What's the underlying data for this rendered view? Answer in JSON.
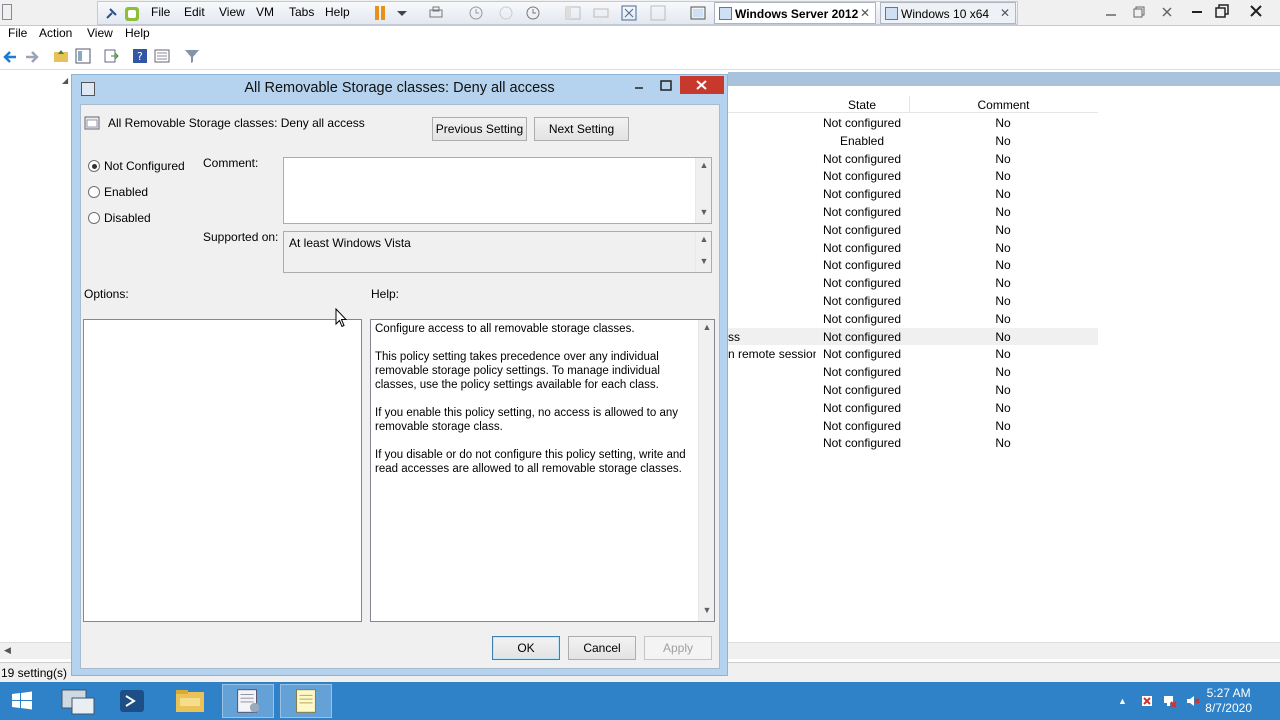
{
  "vmware": {
    "menu": [
      "File",
      "Edit",
      "View",
      "VM",
      "Tabs",
      "Help"
    ],
    "tabs": [
      {
        "label": "Windows Server 2012",
        "active": true
      },
      {
        "label": "Windows 10 x64",
        "active": false
      }
    ],
    "close_glyph": "✕"
  },
  "mmc": {
    "menu": [
      "File",
      "Action",
      "View",
      "Help"
    ],
    "list": {
      "headers": {
        "state": "State",
        "comment": "Comment"
      },
      "rows": [
        {
          "name": "",
          "state": "Not configured",
          "comment": "No"
        },
        {
          "name": "",
          "state": "Enabled",
          "comment": "No"
        },
        {
          "name": "",
          "state": "Not configured",
          "comment": "No"
        },
        {
          "name": "",
          "state": "Not configured",
          "comment": "No"
        },
        {
          "name": "",
          "state": "Not configured",
          "comment": "No"
        },
        {
          "name": "",
          "state": "Not configured",
          "comment": "No"
        },
        {
          "name": "",
          "state": "Not configured",
          "comment": "No"
        },
        {
          "name": "",
          "state": "Not configured",
          "comment": "No"
        },
        {
          "name": "",
          "state": "Not configured",
          "comment": "No"
        },
        {
          "name": "",
          "state": "Not configured",
          "comment": "No"
        },
        {
          "name": "",
          "state": "Not configured",
          "comment": "No"
        },
        {
          "name": "",
          "state": "Not configured",
          "comment": "No"
        },
        {
          "name": "ss",
          "state": "Not configured",
          "comment": "No",
          "selected": true
        },
        {
          "name": "n remote sessions",
          "state": "Not configured",
          "comment": "No"
        },
        {
          "name": "",
          "state": "Not configured",
          "comment": "No"
        },
        {
          "name": "",
          "state": "Not configured",
          "comment": "No"
        },
        {
          "name": "",
          "state": "Not configured",
          "comment": "No"
        },
        {
          "name": "",
          "state": "Not configured",
          "comment": "No"
        },
        {
          "name": "",
          "state": "Not configured",
          "comment": "No"
        }
      ]
    },
    "status": "19 setting(s)"
  },
  "dialog": {
    "title": "All Removable Storage classes: Deny all access",
    "setting_name": "All Removable Storage classes: Deny all access",
    "prev_button": "Previous Setting",
    "next_button": "Next Setting",
    "radios": {
      "not_configured": "Not Configured",
      "enabled": "Enabled",
      "disabled": "Disabled",
      "selected": "not_configured"
    },
    "comment_label": "Comment:",
    "comment_value": "",
    "supported_label": "Supported on:",
    "supported_value": "At least Windows Vista",
    "options_label": "Options:",
    "help_label": "Help:",
    "help_paragraphs": [
      "Configure access to all removable storage classes.",
      "This policy setting takes precedence over any individual removable storage policy settings. To manage individual classes, use the policy settings available for each class.",
      "If you enable this policy setting, no access is allowed to any removable storage class.",
      "If you disable or do not configure this policy setting, write and read accesses are allowed to all removable storage classes."
    ],
    "ok": "OK",
    "cancel": "Cancel",
    "apply": "Apply"
  },
  "taskbar": {
    "time": "5:27 AM",
    "date": "8/7/2020",
    "apps": [
      "start-button",
      "server-manager",
      "powershell",
      "file-explorer",
      "policy-editor",
      "notepad"
    ]
  },
  "colors": {
    "taskbar": "#2f82c8",
    "dialog_frame": "#b5d3ee",
    "close_button": "#c7392c"
  }
}
